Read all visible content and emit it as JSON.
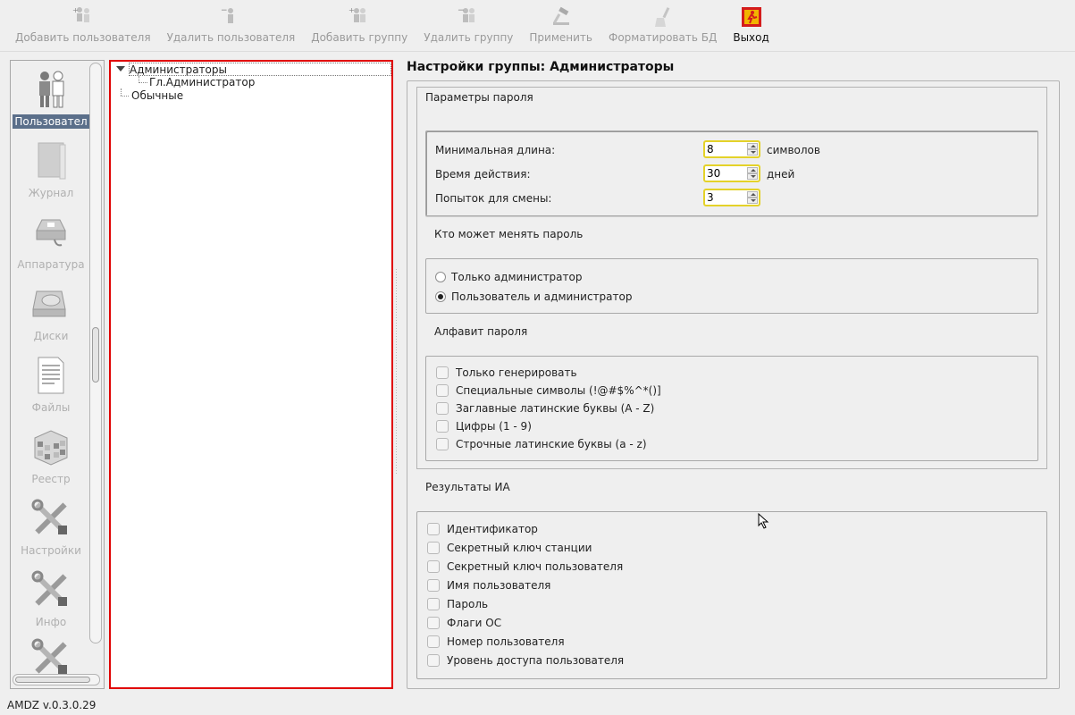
{
  "toolbar": {
    "add_user": "Добавить пользователя",
    "delete_user": "Удалить пользователя",
    "add_group": "Добавить группу",
    "delete_group": "Удалить группу",
    "apply": "Применить",
    "format_db": "Форматировать БД",
    "exit": "Выход"
  },
  "sidebar": {
    "items": [
      {
        "label": "Пользовател",
        "icon": "users-icon",
        "selected": true
      },
      {
        "label": "Журнал",
        "icon": "journal-icon"
      },
      {
        "label": "Аппаратура",
        "icon": "hardware-icon"
      },
      {
        "label": "Диски",
        "icon": "disks-icon"
      },
      {
        "label": "Файлы",
        "icon": "files-icon"
      },
      {
        "label": "Реестр",
        "icon": "registry-icon"
      },
      {
        "label": "Настройки",
        "icon": "settings-icon"
      },
      {
        "label": "Инфо",
        "icon": "info-icon"
      }
    ]
  },
  "tree": {
    "group_admins": "Администраторы",
    "user_chief_admin": "Гл.Администратор",
    "group_regular": "Обычные"
  },
  "settings": {
    "title": "Настройки группы: Администраторы",
    "password_params_title": "Параметры пароля",
    "min_length_label": "Минимальная длина:",
    "min_length_value": "8",
    "min_length_unit": "символов",
    "validity_label": "Время действия:",
    "validity_value": "30",
    "validity_unit": "дней",
    "attempts_label": "Попыток для смены:",
    "attempts_value": "3",
    "who_can_change_title": "Кто может менять пароль",
    "radio_admin_only": "Только администратор",
    "radio_user_and_admin": "Пользователь и администратор",
    "selected_radio": "user_and_admin",
    "alphabet_title": "Алфавит пароля",
    "alphabet_options": [
      "Только генерировать",
      "Специальные символы (!@#$%^*()]",
      "Заглавные латинские буквы (A - Z)",
      "Цифры (1 - 9)",
      "Строчные латинские буквы (a - z)"
    ],
    "ia_results_title": "Результаты ИА",
    "ia_options": [
      "Идентификатор",
      "Секретный ключ станции",
      "Секретный ключ пользователя",
      "Имя пользователя",
      "Пароль",
      "Флаги ОС",
      "Номер пользователя",
      "Уровень доступа пользователя"
    ]
  },
  "status": {
    "version": "AMDZ v.0.3.0.29"
  },
  "colors": {
    "selection": "#5b6f8a",
    "tree_border": "#e00000",
    "spin_focus": "#e4d229"
  }
}
